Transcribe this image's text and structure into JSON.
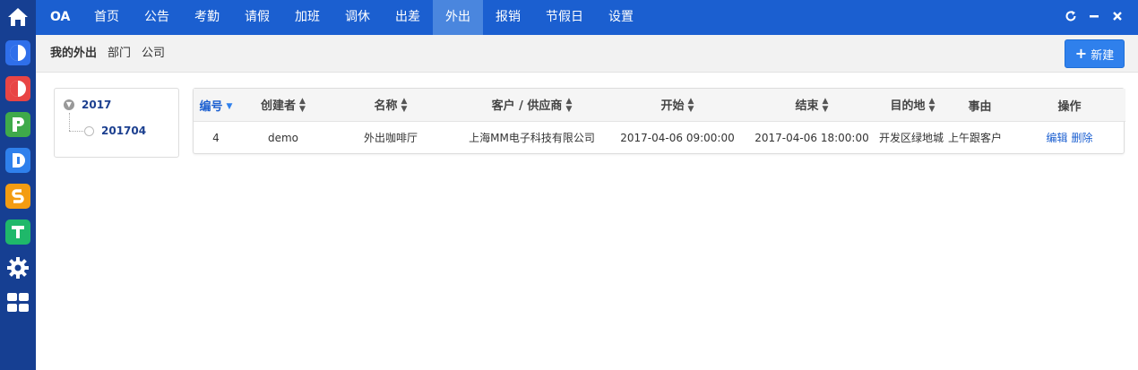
{
  "leftbar": {
    "apps": [
      {
        "name": "home",
        "letter": "",
        "color": ""
      },
      {
        "name": "app-c",
        "letter": "C",
        "color": "#2f6fea"
      },
      {
        "name": "app-o",
        "letter": "O",
        "color": "#e84545"
      },
      {
        "name": "app-p",
        "letter": "P",
        "color": "#3faa4a"
      },
      {
        "name": "app-d",
        "letter": "D",
        "color": "#2f80ec"
      },
      {
        "name": "app-s",
        "letter": "S",
        "color": "#f39c12"
      },
      {
        "name": "app-t",
        "letter": "T",
        "color": "#1fb86a"
      }
    ]
  },
  "topnav": {
    "brand": "OA",
    "menu": [
      "首页",
      "公告",
      "考勤",
      "请假",
      "加班",
      "调休",
      "出差",
      "外出",
      "报销",
      "节假日",
      "设置"
    ],
    "active": "外出"
  },
  "subbar": {
    "tabs": [
      "我的外出",
      "部门",
      "公司"
    ],
    "new_label": "新建"
  },
  "tree": {
    "root": "2017",
    "child": "201704"
  },
  "table": {
    "columns": [
      "编号",
      "创建者",
      "名称",
      "客户 / 供应商",
      "开始",
      "结束",
      "目的地",
      "事由",
      "操作"
    ],
    "rows": [
      {
        "id": "4",
        "creator": "demo",
        "name": "外出咖啡厅",
        "customer": "上海MM电子科技有限公司",
        "start": "2017-04-06 09:00:00",
        "end": "2017-04-06 18:00:00",
        "destination": "开发区绿地城",
        "reason": "上午跟客户",
        "actions": [
          "编辑",
          "删除"
        ]
      }
    ]
  }
}
